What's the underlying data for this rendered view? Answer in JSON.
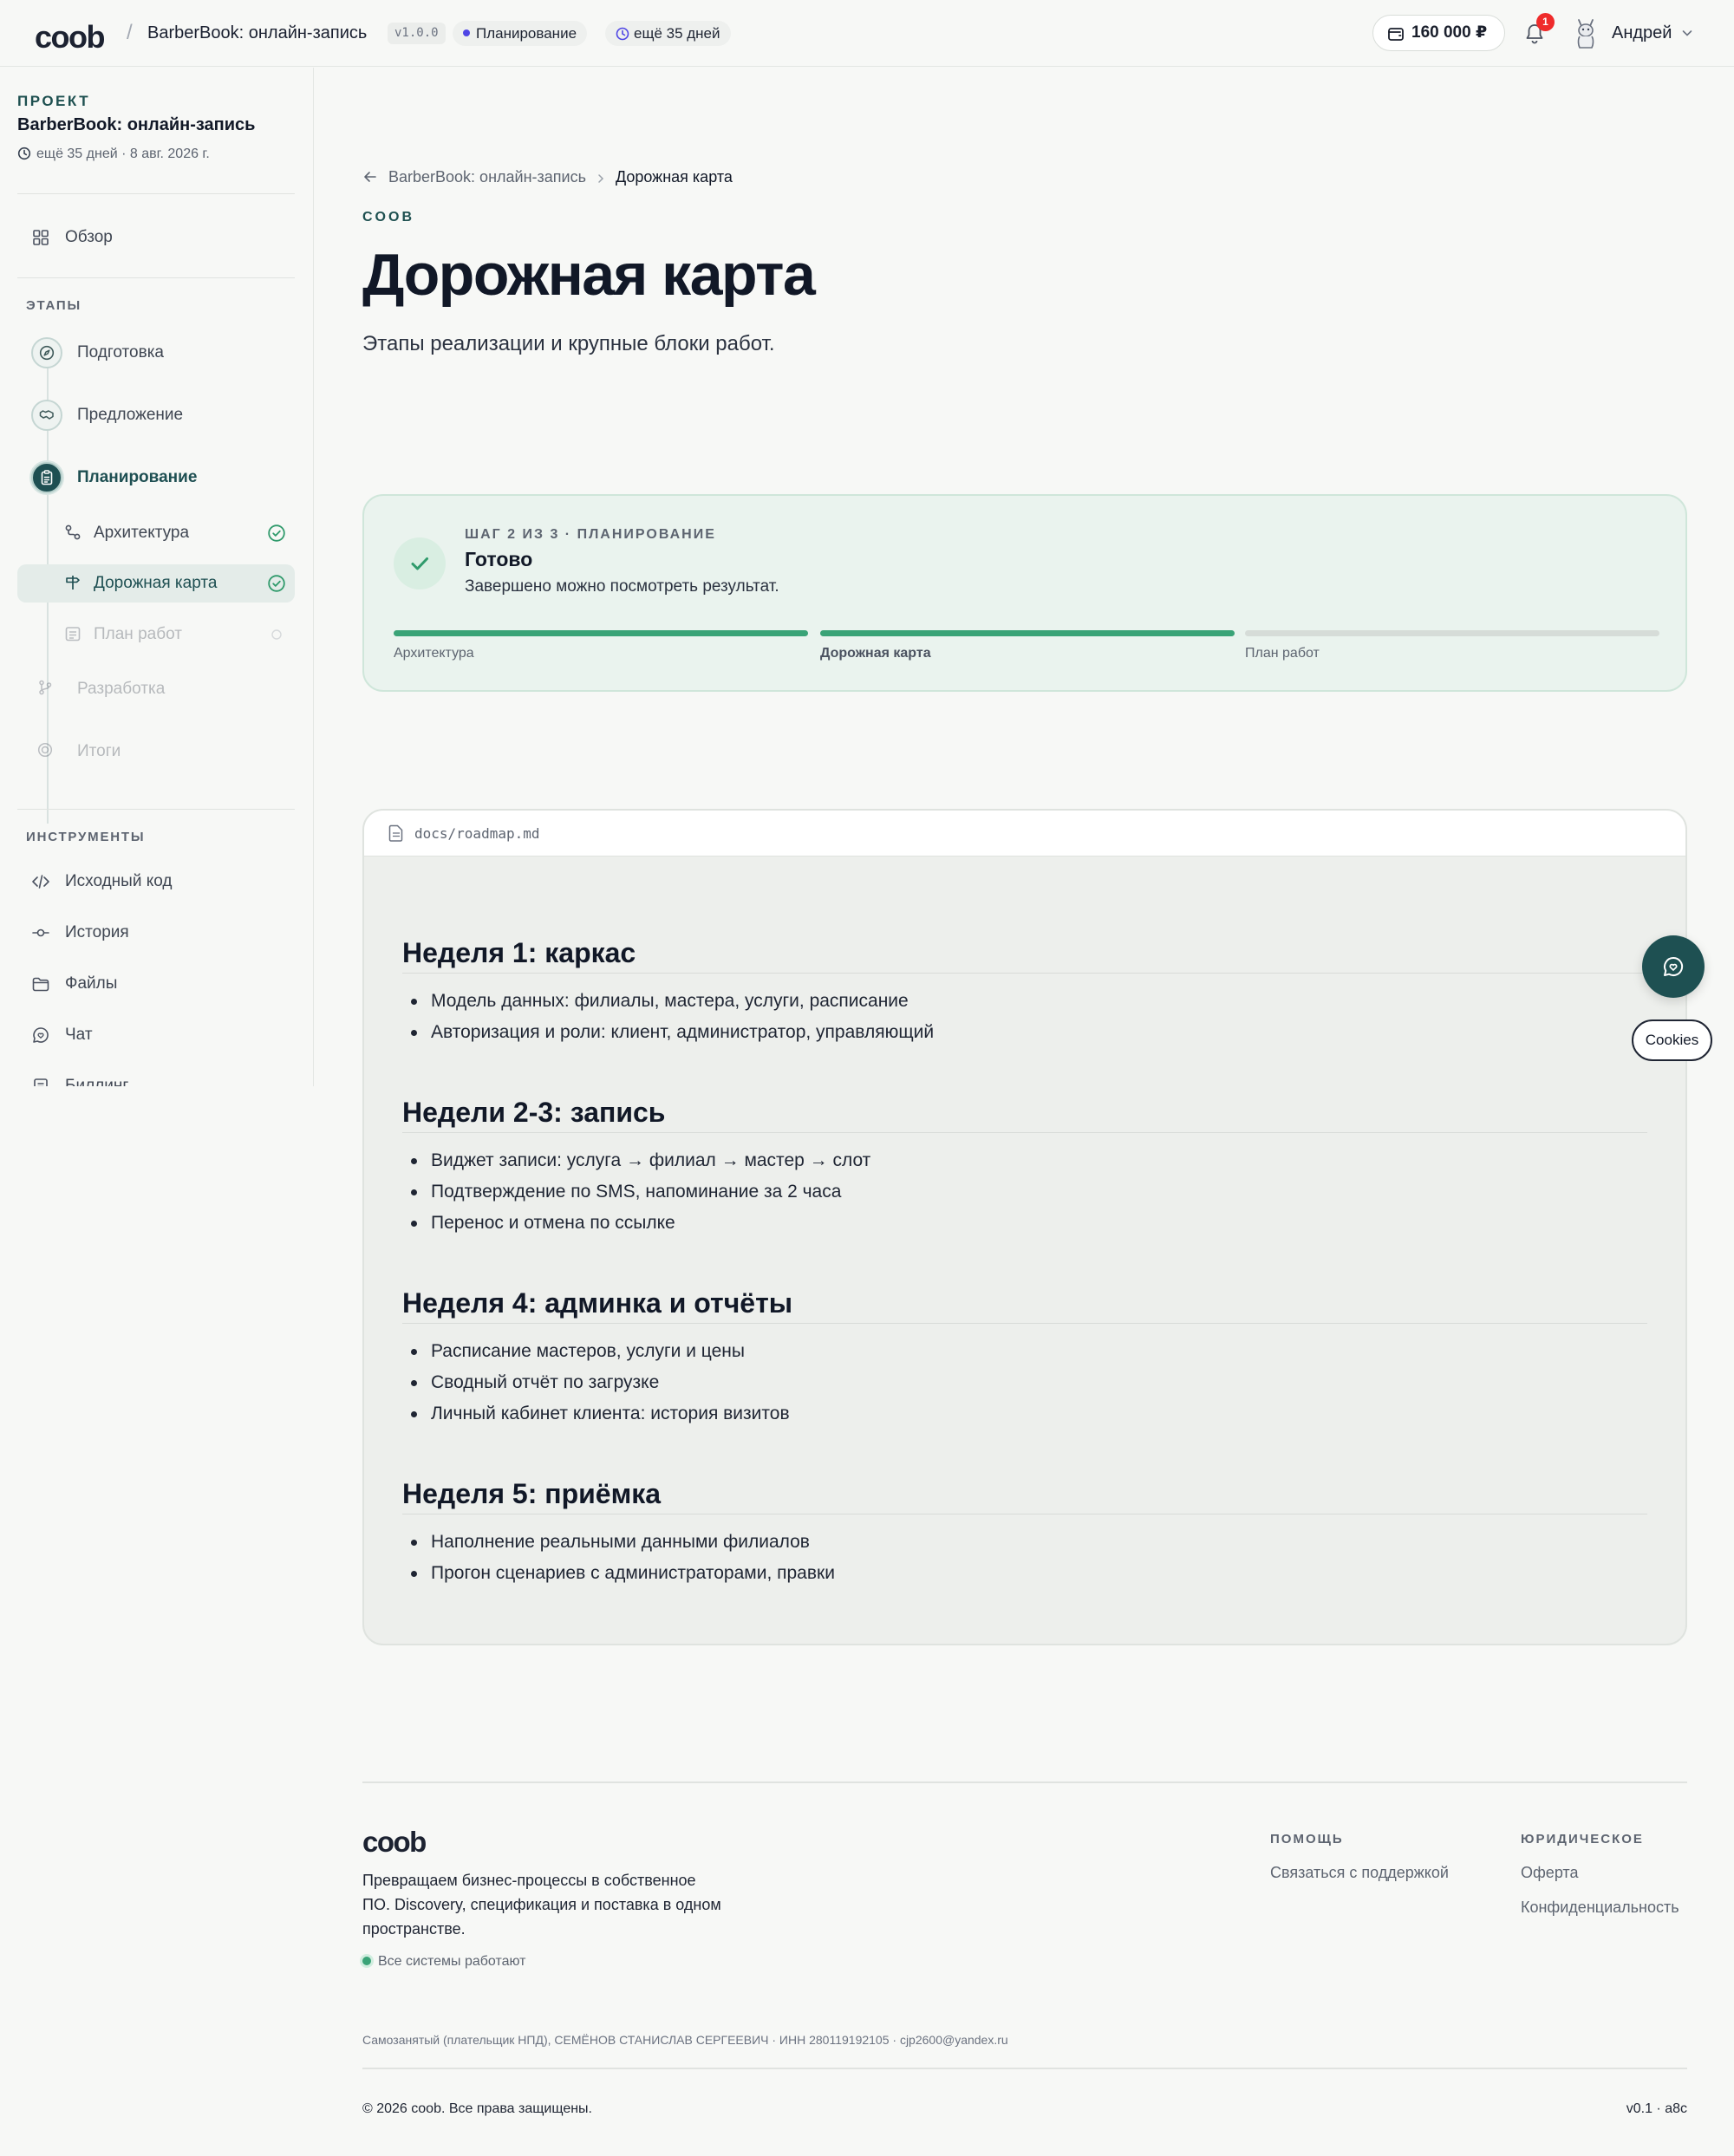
{
  "topbar": {
    "logo": "coob",
    "separator": "/",
    "project_title": "BarberBook: онлайн-запись",
    "version": "v1.0.0",
    "stage_pill": "Планирование",
    "deadline_pill": "ещё 35 дней",
    "balance": "160 000 ₽",
    "notifications_count": "1",
    "user_name": "Андрей"
  },
  "sidebar": {
    "project_label": "ПРОЕКТ",
    "project_name": "BarberBook: онлайн-запись",
    "project_meta": "ещё 35 дней · 8 авг. 2026 г.",
    "overview": "Обзор",
    "stages_label": "ЭТАПЫ",
    "stages": [
      {
        "label": "Подготовка"
      },
      {
        "label": "Предложение"
      },
      {
        "label": "Планирование"
      },
      {
        "label": "Разработка"
      },
      {
        "label": "Итоги"
      }
    ],
    "substeps": [
      {
        "label": "Архитектура"
      },
      {
        "label": "Дорожная карта"
      },
      {
        "label": "План работ"
      }
    ],
    "tools_label": "ИНСТРУМЕНТЫ",
    "tools": [
      {
        "label": "Исходный код"
      },
      {
        "label": "История"
      },
      {
        "label": "Файлы"
      },
      {
        "label": "Чат"
      },
      {
        "label": "Биллинг"
      }
    ]
  },
  "main": {
    "breadcrumb_parent": "BarberBook: онлайн-запись",
    "breadcrumb_current": "Дорожная карта",
    "eyebrow": "COOB",
    "title": "Дорожная карта",
    "subtitle": "Этапы реализации и крупные блоки работ."
  },
  "step_card": {
    "label": "ШАГ 2 ИЗ 3 · ПЛАНИРОВАНИЕ",
    "title": "Готово",
    "description": "Завершено можно посмотреть результат.",
    "steps": [
      {
        "label": "Архитектура",
        "progress": 1.0
      },
      {
        "label": "Дорожная карта",
        "progress": 1.0
      },
      {
        "label": "План работ",
        "progress": 0.0
      }
    ]
  },
  "doc": {
    "path": "docs/roadmap.md",
    "weeks": [
      {
        "title": "Неделя 1: каркас",
        "items": [
          "Модель данных: филиалы, мастера, услуги, расписание",
          "Авторизация и роли: клиент, администратор, управляющий"
        ]
      },
      {
        "title": "Недели 2-3: запись",
        "items": [
          "Виджет записи: услуга → филиал → мастер → слот",
          "Подтверждение по SMS, напоминание за 2 часа",
          "Перенос и отмена по ссылке"
        ]
      },
      {
        "title": "Неделя 4: админка и отчёты",
        "items": [
          "Расписание мастеров, услуги и цены",
          "Сводный отчёт по загрузке",
          "Личный кабинет клиента: история визитов"
        ]
      },
      {
        "title": "Неделя 5: приёмка",
        "items": [
          "Наполнение реальными данными филиалов",
          "Прогон сценариев с администраторами, правки"
        ]
      }
    ]
  },
  "widgets": {
    "cookies": "Cookies"
  },
  "footer": {
    "logo": "coob",
    "tagline": "Превращаем бизнес-процессы в собственное ПО. Discovery, спецификация и поставка в одном пространстве.",
    "status": "Все системы работают",
    "help_title": "ПОМОЩЬ",
    "help_link": "Связаться с поддержкой",
    "legal_title": "ЮРИДИЧЕСКОЕ",
    "legal_links": [
      "Оферта",
      "Конфиденциальность"
    ],
    "legal_text": "Самозанятый (плательщик НПД), СЕМЁНОВ СТАНИСЛАВ СЕРГЕЕВИЧ · ИНН 280119192105 · cjp2600@yandex.ru",
    "copyright": "© 2026 coob. Все права защищены.",
    "version": "v0.1 · a8c"
  },
  "colors": {
    "accent": "#1e5052",
    "success": "#3aa377",
    "badge": "#ef2b2b",
    "stage_dot": "#4f46e5"
  }
}
